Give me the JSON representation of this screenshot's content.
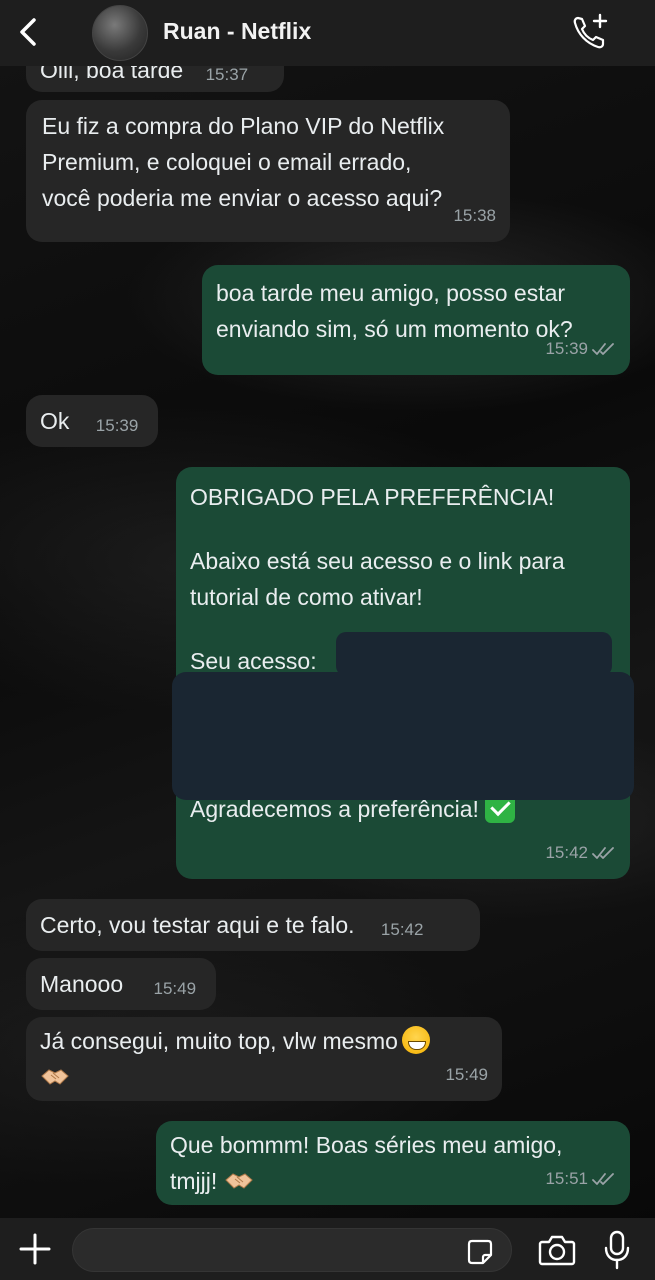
{
  "header": {
    "contact_name": "Ruan - Netflix",
    "icons": {
      "back": "chevron-left-icon",
      "call": "phone-plus-icon"
    }
  },
  "messages": [
    {
      "dir": "in",
      "lines": [
        "Oiii, boa tarde"
      ],
      "time": "15:37"
    },
    {
      "dir": "in",
      "lines": [
        "Eu fiz a compra do Plano VIP do Netflix",
        "Premium, e coloquei o email errado,",
        "você poderia me enviar o acesso aqui?"
      ],
      "time": "15:38"
    },
    {
      "dir": "out",
      "lines": [
        "boa tarde meu amigo, posso estar",
        "enviando sim, só um momento ok?"
      ],
      "time": "15:39"
    },
    {
      "dir": "in",
      "lines": [
        "Ok"
      ],
      "time": "15:39"
    },
    {
      "dir": "out",
      "lines": [
        "OBRIGADO PELA PREFERÊNCIA!",
        "Abaixo está seu acesso e o link para",
        "tutorial de como ativar!",
        "Seu acesso:",
        "Agradecemos a preferência!"
      ],
      "time": "15:42"
    },
    {
      "dir": "in",
      "lines": [
        "Certo, vou testar aqui e te falo."
      ],
      "time": "15:42"
    },
    {
      "dir": "in",
      "lines": [
        "Manooo"
      ],
      "time": "15:49"
    },
    {
      "dir": "in",
      "lines": [
        "Já consegui, muito top, vlw mesmo"
      ],
      "time": "15:49"
    },
    {
      "dir": "out",
      "lines": [
        "Que bommm! Boas séries meu amigo,",
        "tmjjj!"
      ],
      "time": "15:51"
    }
  ],
  "composer": {
    "value": "",
    "placeholder": ""
  },
  "colors": {
    "incoming": "#262626",
    "outgoing": "#1b4a36",
    "header": "#1e1e1e"
  }
}
